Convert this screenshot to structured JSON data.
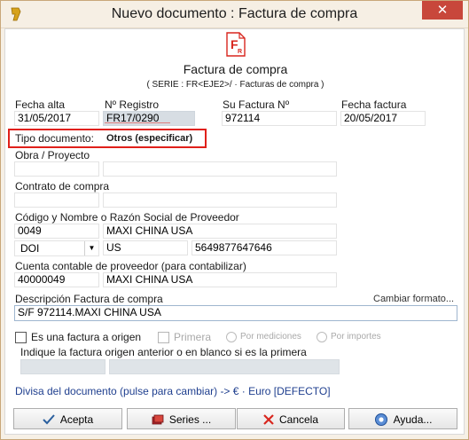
{
  "window": {
    "title": "Nuevo documento : Factura de compra",
    "close_glyph": "✕"
  },
  "header": {
    "doc_icon_letter": "F",
    "doc_icon_sub": "R",
    "heading": "Factura de compra",
    "subheading": "( SERIE : FR<EJE2>/ · Facturas de compra )"
  },
  "dates": {
    "fecha_alta_label": "Fecha alta",
    "fecha_alta_value": "31/05/2017",
    "registro_label": "Nº Registro",
    "registro_value": "FR17/0290",
    "su_factura_label": "Su Factura Nº",
    "su_factura_value": "972114",
    "fecha_factura_label": "Fecha factura",
    "fecha_factura_value": "20/05/2017"
  },
  "tipo": {
    "label": "Tipo documento:",
    "value": "Otros (especificar)",
    "highlight_color": "#e0201a"
  },
  "obra": {
    "label": "Obra / Proyecto",
    "code": "",
    "name": ""
  },
  "contrato": {
    "label": "Contrato de compra",
    "code": "",
    "name": ""
  },
  "proveedor": {
    "label": "Código y Nombre o Razón Social de Proveedor",
    "code": "0049",
    "name": "MAXI CHINA USA",
    "doc_type": "DOI",
    "country": "US",
    "doc_number": "5649877647646"
  },
  "cuenta": {
    "label": "Cuenta contable de proveedor (para contabilizar)",
    "code": "40000049",
    "name": "MAXI CHINA USA"
  },
  "descripcion": {
    "label": "Descripción Factura de compra",
    "change_format": "Cambiar formato...",
    "value": "S/F 972114.MAXI CHINA USA"
  },
  "origen": {
    "es_origen_label": "Es una factura a origen",
    "primera_label": "Primera",
    "mediciones_label": "Por mediciones",
    "importes_label": "Por importes",
    "hint": "Indique la factura origen anterior o en blanco si es la primera"
  },
  "divisa": {
    "text": "Divisa del documento (pulse para cambiar) -> € · Euro [DEFECTO]",
    "color": "#1f3f8f"
  },
  "buttons": {
    "accept": "Acepta",
    "series": "Series ...",
    "cancel": "Cancela",
    "help": "Ayuda..."
  },
  "colors": {
    "window_border": "#c9a77a",
    "close_red": "#c8473b",
    "icon_red": "#d8261e",
    "accept_check": "#2a5f9e"
  }
}
